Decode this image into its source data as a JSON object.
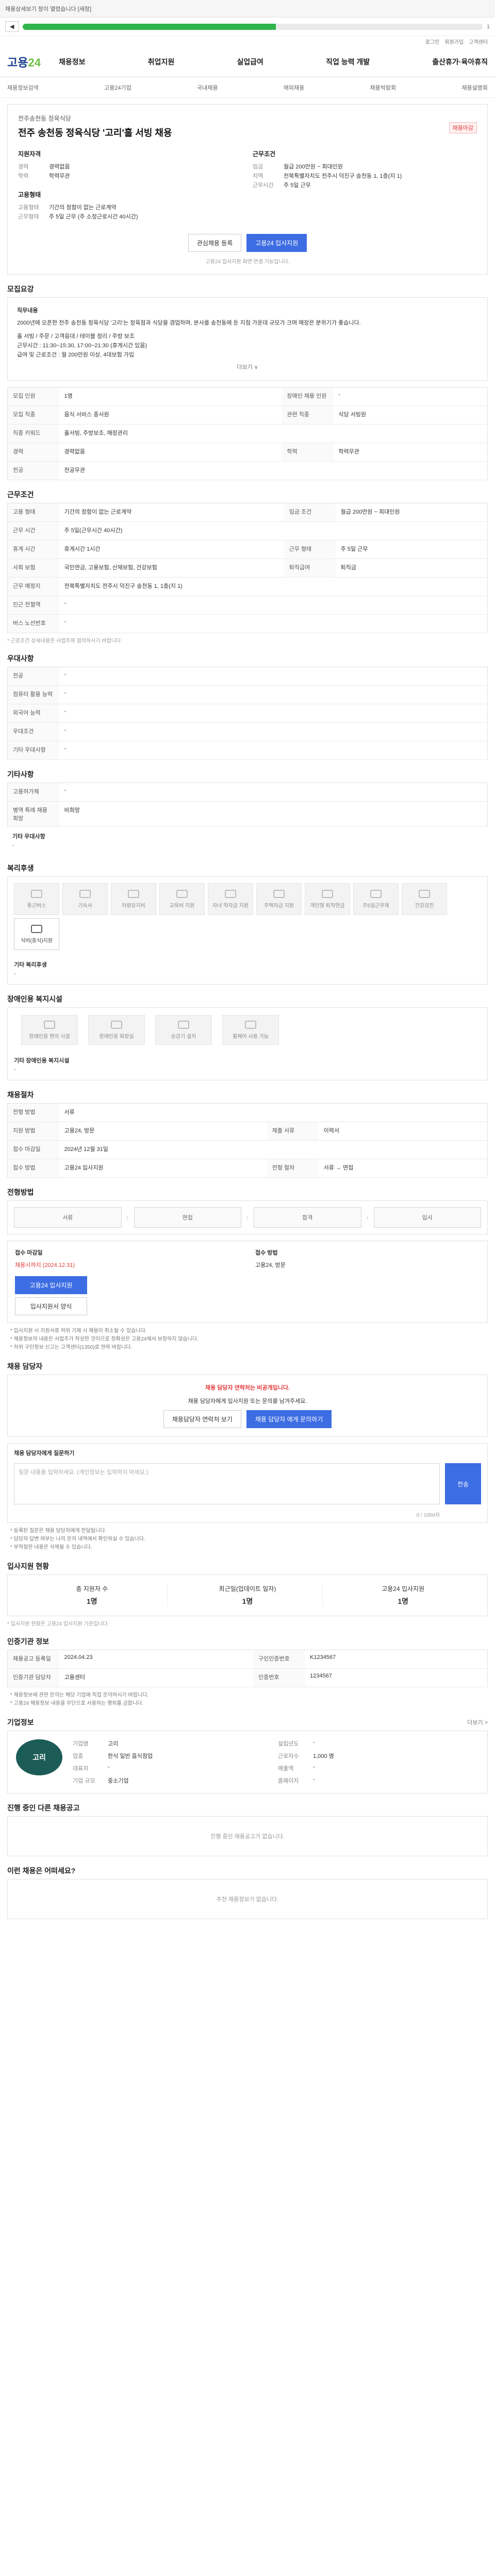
{
  "topbar": {
    "text": "채용상세보기 창이 열렸습니다 [새창]"
  },
  "toolbar": {
    "progress_label": "1",
    "progress_pct": 55
  },
  "util": {
    "links": [
      "로그인",
      "회원가입",
      "고객센터"
    ]
  },
  "logo": {
    "main": "고용",
    "sub": "24"
  },
  "gnb": [
    "채용정보",
    "취업지원",
    "실업급여",
    "직업 능력 개발",
    "출산휴가·육아휴직"
  ],
  "subnav": [
    "채용정보검색",
    "고용24기업",
    "국내채용",
    "해외채용",
    "채용박람회",
    "채용설명회"
  ],
  "summary": {
    "company": "전주송천동 정육식당",
    "title": "전주 송천동 정육식당 '고리'홀 서빙 채용",
    "badge": "채용마감",
    "left_head": "지원자격",
    "right_head": "근무조건",
    "left": [
      {
        "k": "경력",
        "v": "경력없음"
      },
      {
        "k": "학력",
        "v": "학력무관"
      }
    ],
    "right": [
      {
        "k": "임금",
        "v": "월급 200만원 ~ 최대인원"
      },
      {
        "k": "지역",
        "v": "전북특별자치도 전주시 덕진구 송천동 1, 1층(지 1)"
      },
      {
        "k": "근무시간",
        "v": "주 5일 근무"
      }
    ],
    "left2_head": "고용형태",
    "left2": [
      {
        "k": "고용형태",
        "v": "기간의 정함이 없는 근로계약"
      },
      {
        "k": "근무형태",
        "v": "주 5일 근무 (주 소정근로시간 40시간)"
      }
    ],
    "btn_scrap": "관심채용 등록",
    "btn_apply": "고용24 입사지원",
    "note": "고용24 입사지원 화면 연결 기능입니다."
  },
  "desc": {
    "title": "모집요강",
    "head": "직무내용",
    "text1": "2000년에 오픈한 전주 송천동 정육식당 '고리'는 정육점과 식당을 겸업하며, 본사를 송천동에 둔 지점 가운데 규모가 크며 매장은 분위기가 좋습니다.",
    "text2": "홀 서빙 / 주문 / 고객응대 / 테이블 정리 / 주방 보조",
    "text3": "근무시간 : 11:30~15:30, 17:00~21:30 (휴게시간 있음)",
    "text4": "급여 및 근로조건 : 월 200만원 이상, 4대보험 가입",
    "more": "더보기 ∨"
  },
  "recruit": {
    "rows": [
      {
        "k1": "모집 인원",
        "v1": "1명",
        "k2": "장애인 채용 인원",
        "v2": "-"
      },
      {
        "k1": "모집 직종",
        "v1": "음식 서비스 종사원",
        "k2": "관련 직종",
        "v2": "식당 서빙원"
      },
      {
        "k1": "직종 키워드",
        "v1": "홀서빙, 주방보조, 매장관리",
        "k2": "",
        "v2": ""
      },
      {
        "k1": "경력",
        "v1": "경력없음",
        "k2": "학력",
        "v2": "학력무관"
      },
      {
        "k1": "전공",
        "v1": "전공무관",
        "k2": "",
        "v2": ""
      }
    ]
  },
  "work": {
    "title": "근무조건",
    "rows": [
      {
        "k": "고용 형태",
        "v": "기간의 정함이 없는 근로계약",
        "k2": "임금 조건",
        "v2": "월급 200만원 ~ 최대인원"
      },
      {
        "k": "근무 시간",
        "v": "주 5일(근무시간 40시간)",
        "k2": "",
        "v2": ""
      },
      {
        "k": "휴게 시간",
        "v": "휴게시간 1시간",
        "k2": "근무 형태",
        "v2": "주 5일 근무"
      },
      {
        "k": "사회 보험",
        "v": "국민연금, 고용보험, 산재보험, 건강보험",
        "k2": "퇴직급여",
        "v2": "퇴직금"
      },
      {
        "k": "근무 예정지",
        "v": "전북특별자치도 전주시 덕진구 송천동 1, 1층(지 1)",
        "k2": "",
        "v2": ""
      },
      {
        "k": "인근 전철역",
        "v": "-",
        "k2": "",
        "v2": ""
      },
      {
        "k": "버스 노선번호",
        "v": "-",
        "k2": "",
        "v2": ""
      }
    ],
    "note": "* 근로조건 상세내용은 사업주와 협의하시기 바랍니다."
  },
  "pref": {
    "title": "우대사항",
    "rows": [
      {
        "k": "전공",
        "v": "-"
      },
      {
        "k": "컴퓨터 활용 능력",
        "v": "-"
      },
      {
        "k": "외국어 능력",
        "v": "-"
      },
      {
        "k": "우대조건",
        "v": "-"
      },
      {
        "k": "기타 우대사항",
        "v": "-"
      }
    ]
  },
  "etc": {
    "title": "기타사항",
    "rows": [
      {
        "k": "고용허가제",
        "v": "-"
      },
      {
        "k": "병역 특례 채용 희망",
        "v": "비희망"
      }
    ],
    "sub_title": "기타 우대사항",
    "sub_value": "-"
  },
  "welfare": {
    "title": "복리후생",
    "items": [
      {
        "label": "통근버스",
        "on": false
      },
      {
        "label": "기숙사",
        "on": false
      },
      {
        "label": "차량유지비",
        "on": false
      },
      {
        "label": "교육비 지원",
        "on": false
      },
      {
        "label": "자녀 학자금 지원",
        "on": false
      },
      {
        "label": "주택자금 지원",
        "on": false
      },
      {
        "label": "개인형 퇴직연금",
        "on": false
      },
      {
        "label": "주5일근무제",
        "on": false
      },
      {
        "label": "건강검진",
        "on": false
      },
      {
        "label": "식비(중식)지원",
        "on": true
      }
    ],
    "extra_title": "기타 복리후생",
    "extra_value": "-"
  },
  "disab": {
    "title": "장애인용 복지시설",
    "items": [
      "장애인용 편의 시설",
      "장애인용 화장실",
      "승강기 설치",
      "휠체어 사용 가능"
    ],
    "extra_title": "기타 장애인용 복지시설",
    "extra_value": "-"
  },
  "select": {
    "title": "채용절차",
    "rows": [
      {
        "k": "전형 방법",
        "v": "서류",
        "k2": "",
        "v2": ""
      },
      {
        "k": "지원 방법",
        "v": "고용24, 방문",
        "k2": "제출 서류",
        "v2": "이력서"
      },
      {
        "k": "접수 마감일",
        "v": "2024년 12월 31일",
        "k2": "",
        "v2": ""
      },
      {
        "k": "접수 방법",
        "v": "고용24 입사지원",
        "k2": "전형 절차",
        "v2": "서류 → 면접"
      }
    ]
  },
  "process": {
    "title": "전형방법",
    "steps": [
      "서류",
      "면접",
      "합격",
      "입사"
    ]
  },
  "apply": {
    "label": "접수 마감일",
    "deadline": "채용시까지 (2024.12.31)",
    "method_label": "접수 방법",
    "methods": "고용24, 방문",
    "btn_apply": "고용24 입사지원",
    "btn_form": "입사지원서 양식",
    "notes": [
      "* 입사지원 시 지원서류 허위 기재 시 채용이 취소될 수 있습니다.",
      "* 채용정보의 내용은 사업주가 작성한 것이므로 정확성은 고용24에서 보장하지 않습니다.",
      "* 허위 구인정보 신고는 고객센터(1350)로 연락 바랍니다."
    ]
  },
  "contact": {
    "title": "채용 담당자",
    "warn": "채용 담당자 연락처는 비공개입니다.",
    "text": "채용 담당자에게 입사지원 또는 문의를 남겨주세요.",
    "btn1": "채용담당자 연락처 보기",
    "btn2": "채용 담당자 에게 문의하기"
  },
  "inquiry": {
    "label": "채용 담당자에게 질문하기",
    "placeholder": "질문 내용을 입력하세요. (개인정보는 입력하지 마세요.)",
    "send": "전송",
    "counter": "0 / 1000자",
    "notes": [
      "* 등록된 질문은 채용 담당자에게 전달됩니다.",
      "* 담당자 답변 여부는 나의 문의 내역에서 확인하실 수 있습니다.",
      "* 부적절한 내용은 삭제될 수 있습니다."
    ]
  },
  "stats": {
    "title": "입사지원 현황",
    "items": [
      {
        "label": "총 지원자 수",
        "value": "1명"
      },
      {
        "label": "최근일(업데이트 일자)",
        "value": "1명"
      },
      {
        "label": "고용24 입사지원",
        "value": "1명"
      }
    ],
    "note": "* 입사지원 현황은 고용24 입사지원 기준입니다."
  },
  "info": {
    "title": "인증기관 정보",
    "rows": [
      {
        "k": "채용공고 등록일",
        "v": "2024.04.23",
        "k2": "구인인증번호",
        "v2": "K1234567"
      },
      {
        "k": "인증기관 담당자",
        "v": "고용센터",
        "k2": "인증번호",
        "v2": "1234567"
      }
    ],
    "notes": [
      "* 채용정보에 관한 문의는 해당 기업에 직접 문의하시기 바랍니다.",
      "* 고용24 채용정보 내용을 무단으로 사용하는 행위를 금합니다."
    ]
  },
  "company": {
    "title": "기업정보",
    "logo_text": "고리",
    "more": "더보기 >",
    "rows": [
      {
        "k": "기업명",
        "v": "고리",
        "k2": "설립년도",
        "v2": "-"
      },
      {
        "k": "업종",
        "v": "한식 일반 음식점업",
        "k2": "근로자수",
        "v2": "1,000 명"
      },
      {
        "k": "대표자",
        "v": "-",
        "k2": "매출액",
        "v2": "-"
      },
      {
        "k": "기업 규모",
        "v": "중소기업",
        "k2": "홈페이지",
        "v2": "-"
      }
    ]
  },
  "other": {
    "title": "진행 중인 다른 채용공고",
    "empty": "진행 중인 채용공고가 없습니다."
  },
  "recommend": {
    "title": "이런 채용은 어떠세요?",
    "empty": "추천 채용정보가 없습니다."
  }
}
